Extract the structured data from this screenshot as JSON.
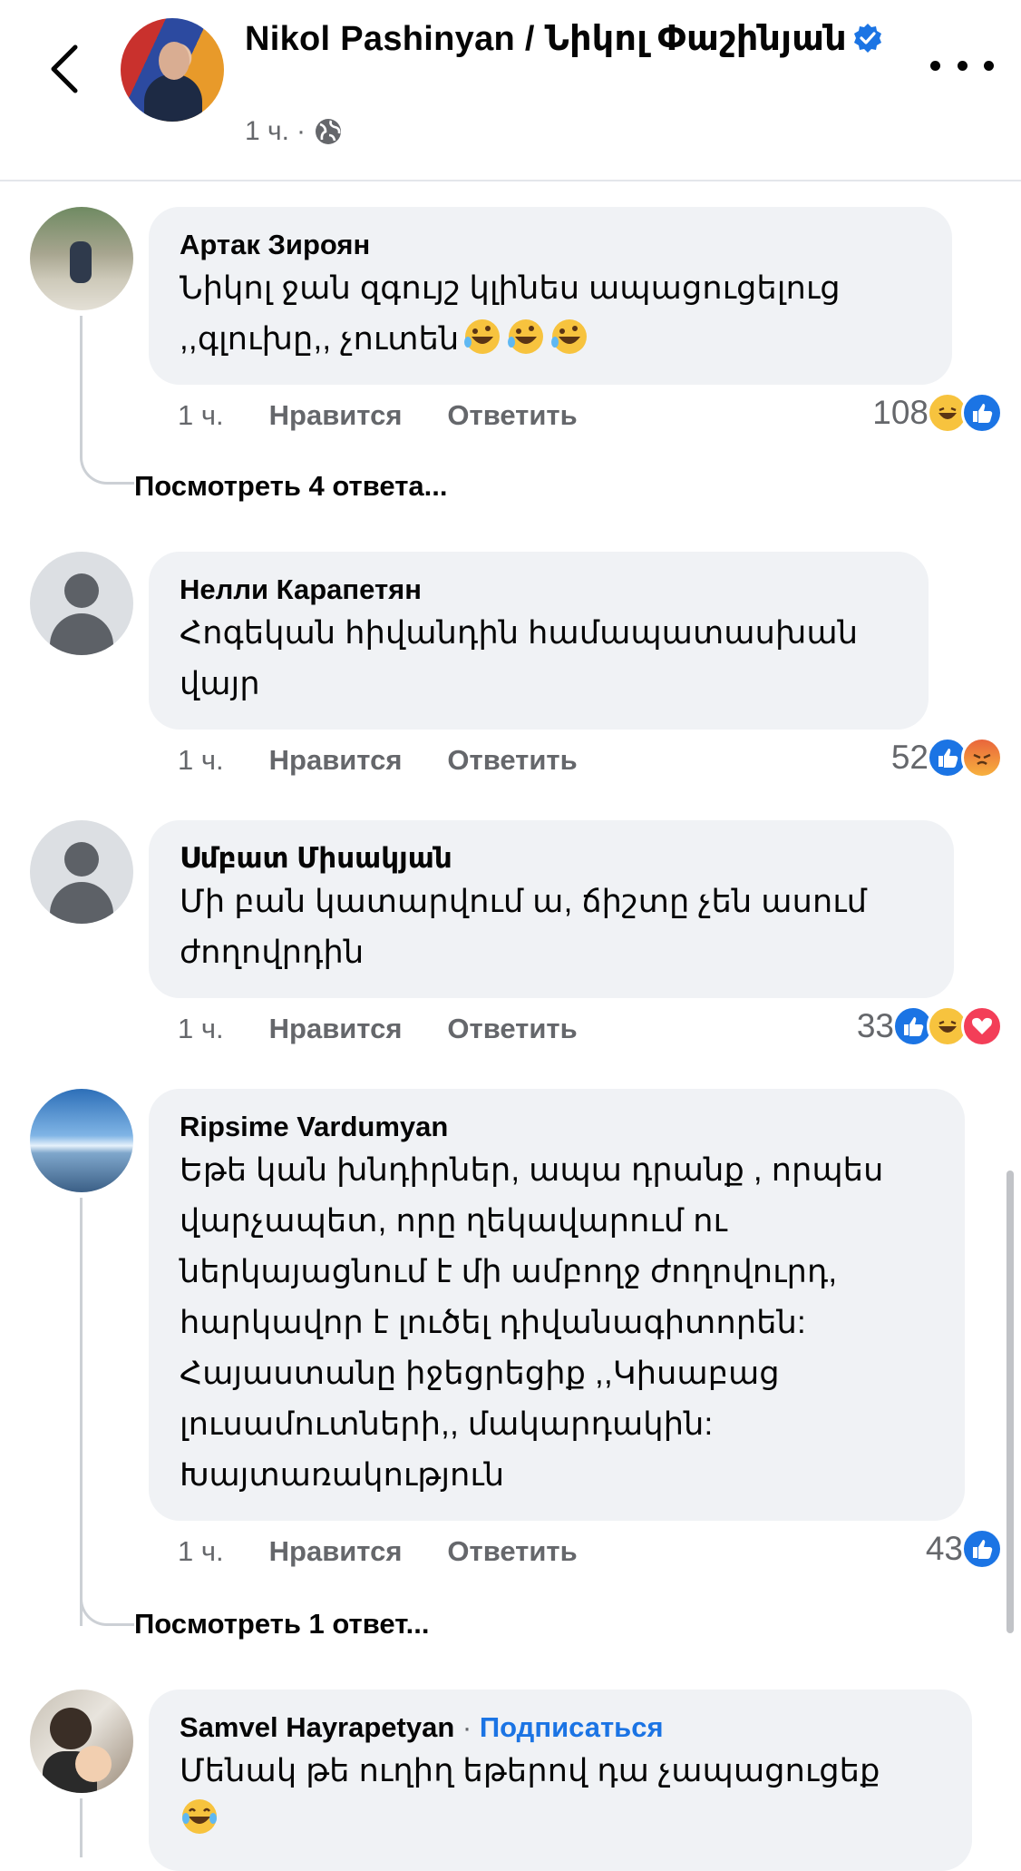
{
  "header": {
    "name": "Nikol Pashinyan / Նիկոլ Փաշինյան",
    "time": "1 ч.",
    "separator": "·"
  },
  "colors": {
    "link": "#1b74e4",
    "bubble": "#f0f2f5",
    "secondary_text": "#65676b"
  },
  "comments": [
    {
      "author": "Артак Зироян",
      "text": "Նիկոլ ջան զգույշ կլինես ապացուցելուց ,,գլուխը,, չուտեն",
      "time": "1 ч.",
      "like": "Нравится",
      "reply": "Ответить",
      "reaction_count": "108",
      "reactions": [
        "haha",
        "like"
      ],
      "view_replies": "Посмотреть 4 ответа..."
    },
    {
      "author": "Нелли Карапетян",
      "text": "Հոգեկան հիվանդին համապատասխան վայր",
      "time": "1 ч.",
      "like": "Нравится",
      "reply": "Ответить",
      "reaction_count": "52",
      "reactions": [
        "like",
        "angry"
      ]
    },
    {
      "author": "Սմբատ Միսակյան",
      "text": "Մի բան կատարվում ա, ճիշտը չեն ասում ժողովրդին",
      "time": "1 ч.",
      "like": "Нравится",
      "reply": "Ответить",
      "reaction_count": "33",
      "reactions": [
        "like",
        "haha",
        "love"
      ]
    },
    {
      "author": "Ripsime Vardumyan",
      "text": "Եթե կան խնդիրներ, ապա դրանք , որպես վարչապետ, որը ղեկավարում ու ներկայացնում է մի ամբողջ ժողովուրդ, հարկավոր է լուծել դիվանագիտորեն: Հայաստանը իջեցրեցիք ,,Կիսաբաց լուսամուտների,, մակարդակին: Խայտառակություն",
      "time": "1 ч.",
      "like": "Нравится",
      "reply": "Ответить",
      "reaction_count": "43",
      "reactions": [
        "like"
      ],
      "view_replies": "Посмотреть 1 ответ..."
    },
    {
      "author": "Samvel Hayrapetyan",
      "follow": "Подписаться",
      "separator": "·",
      "text": "Մենակ թե ուղիղ եթերով դա չապացուցեք"
    }
  ]
}
